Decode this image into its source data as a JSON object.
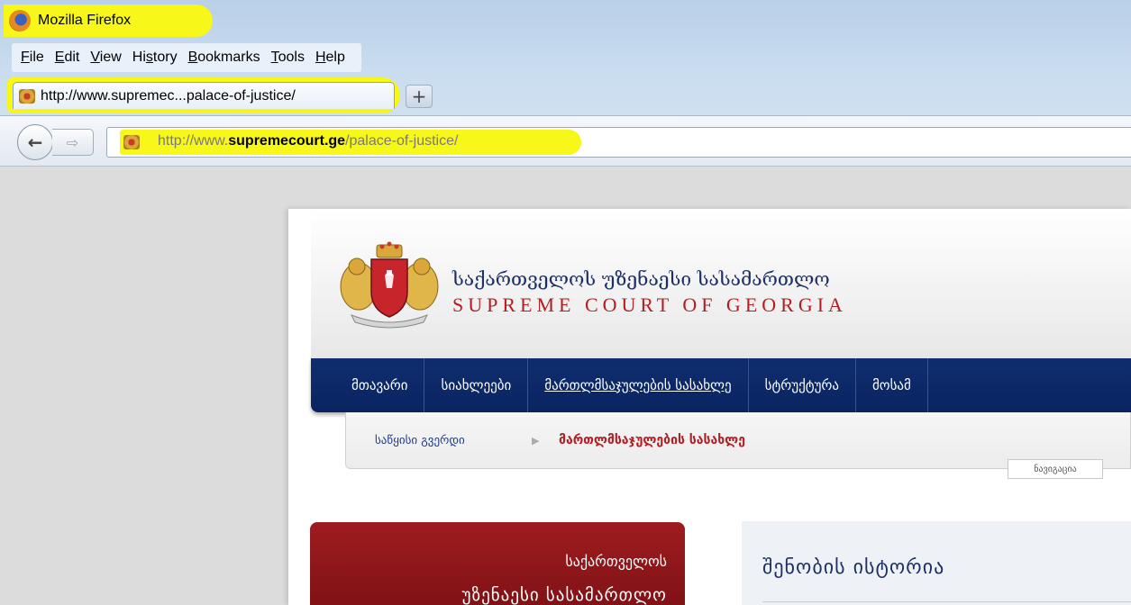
{
  "window": {
    "app_title": "Mozilla Firefox"
  },
  "menubar": {
    "items": [
      {
        "pre": "",
        "key": "F",
        "post": "ile"
      },
      {
        "pre": "",
        "key": "E",
        "post": "dit"
      },
      {
        "pre": "",
        "key": "V",
        "post": "iew"
      },
      {
        "pre": "Hi",
        "key": "s",
        "post": "tory"
      },
      {
        "pre": "",
        "key": "B",
        "post": "ookmarks"
      },
      {
        "pre": "",
        "key": "T",
        "post": "ools"
      },
      {
        "pre": "",
        "key": "H",
        "post": "elp"
      }
    ]
  },
  "tab": {
    "title": "http://www.supremec...palace-of-justice/",
    "new_tab_label": "+"
  },
  "navbar": {
    "back_glyph": "←",
    "forward_glyph": "⇨",
    "url_prefix": "http://www.",
    "url_domain": "supremecourt.ge",
    "url_path": "/palace-of-justice/"
  },
  "site": {
    "name_ge": "საქართველოს უზენაესი სასამართლო",
    "name_en": "SUPREME COURT OF GEORGIA"
  },
  "main_nav": {
    "items": [
      {
        "label": "მთავარი"
      },
      {
        "label": "სიახლეები"
      },
      {
        "label": "მართლმსაჯულების სასახლე",
        "active": true
      },
      {
        "label": "სტრუქტურა"
      },
      {
        "label": "მოსამ"
      }
    ]
  },
  "breadcrumb": {
    "home": "საწყისი გვერდი",
    "separator": "▶",
    "current": "მართლმსაჯულების სასახლე",
    "nav_tag": "ნავიგაცია"
  },
  "red_panel": {
    "line1": "საქართველოს",
    "line2": "უზენაესი სასამართლო"
  },
  "content": {
    "title": "შენობის ისტორია"
  },
  "colors": {
    "highlight": "#f7f719",
    "nav_blue": "#0f2d6e",
    "brand_red": "#b11e23"
  }
}
